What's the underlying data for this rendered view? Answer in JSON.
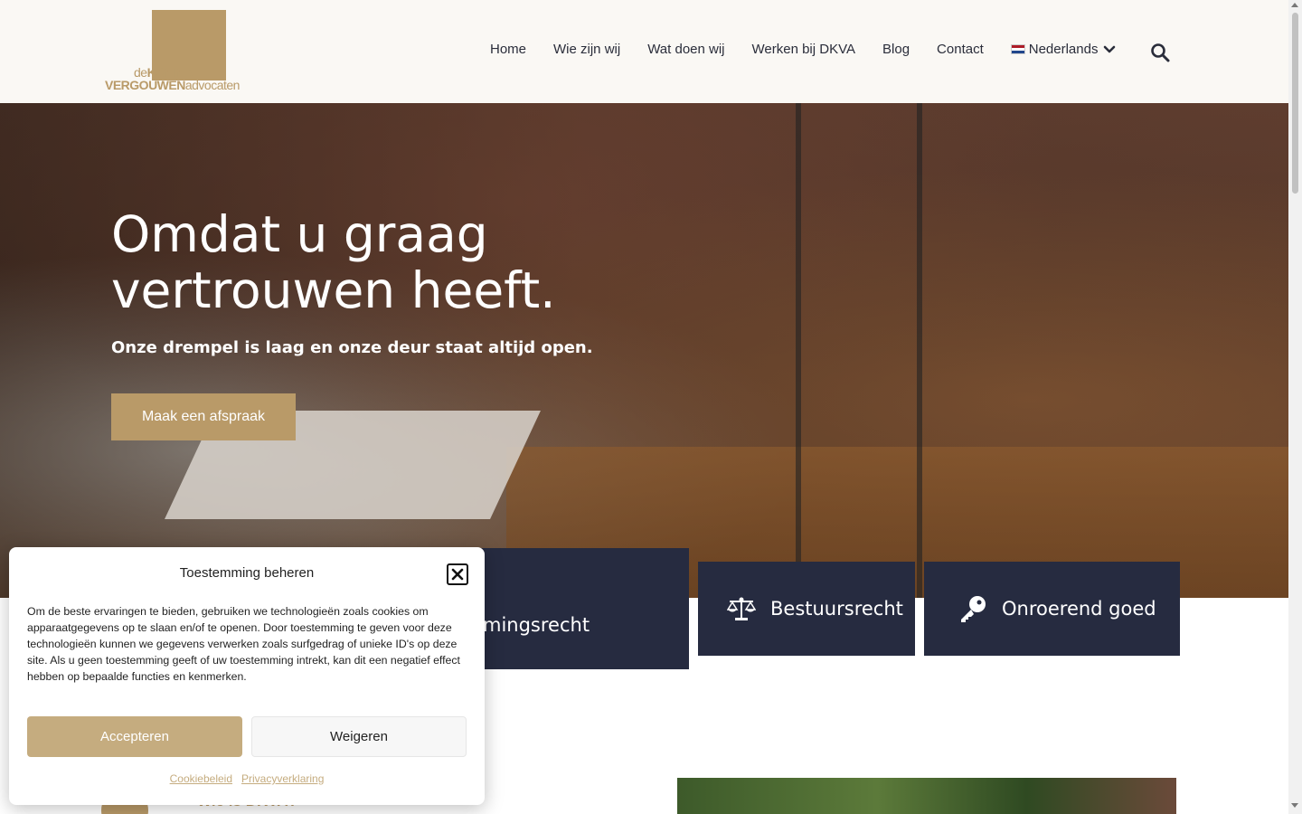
{
  "header": {
    "logo": {
      "line1_thin": "de",
      "line1_bold": "KONING",
      "line2_bold": "VERGOUWEN",
      "line2_thin": "advocaten"
    },
    "nav": [
      {
        "label": "Home"
      },
      {
        "label": "Wie zijn wij"
      },
      {
        "label": "Wat doen wij"
      },
      {
        "label": "Werken bij DKVA"
      },
      {
        "label": "Blog"
      },
      {
        "label": "Contact"
      }
    ],
    "language": {
      "label": "Nederlands",
      "flag": "nl-flag-icon"
    },
    "search_icon": "search-icon"
  },
  "hero": {
    "title": "Omdat u graag vertrouwen heeft.",
    "subtitle": "Onze drempel is laag en onze deur staat altijd open.",
    "cta": "Maak een afspraak"
  },
  "services": [
    {
      "label": "mingsrecht",
      "icon": ""
    },
    {
      "label": "Bestuursrecht",
      "icon": "scales-icon"
    },
    {
      "label": "Onroerend goed",
      "icon": "key-icon"
    }
  ],
  "bottom": {
    "heading": "Wie is DKVA?"
  },
  "cookie": {
    "title": "Toestemming beheren",
    "text": "Om de beste ervaringen te bieden, gebruiken we technologieën zoals cookies om apparaatgegevens op te slaan en/of te openen. Door toestemming te geven voor deze technologieën kunnen we gegevens verwerken zoals surfgedrag of unieke ID's op deze site. Als u geen toestemming geeft of uw toestemming intrekt, kan dit een negatief effect hebben op bepaalde functies en kenmerken.",
    "accept": "Accepteren",
    "deny": "Weigeren",
    "links": [
      "Cookiebeleid",
      "Privacyverklaring"
    ]
  },
  "colors": {
    "brand_gold": "#b99a68",
    "navy": "#262b40",
    "header_bg": "#faf8f4"
  }
}
